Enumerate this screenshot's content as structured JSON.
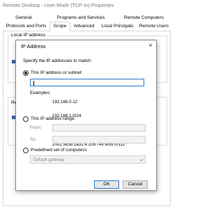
{
  "window": {
    "title": "Remote Desktop - User Mode (TCP-In) Properties"
  },
  "tabs": {
    "row1": [
      "General",
      "Programs and Services",
      "Remote Computers"
    ],
    "row2": [
      "Protocols and Ports",
      "Scope",
      "Advanced",
      "Local Principals",
      "Remote Users"
    ],
    "selected": "Scope"
  },
  "scope": {
    "local_group_label": "Local IP address",
    "remote_group_label": "Re"
  },
  "dialog": {
    "title": "IP Address",
    "close": "×",
    "prompt": "Specify the IP addresses to match:",
    "option_subnet": "This IP address or subnet:",
    "subnet_value": "",
    "examples_label": "Examples:",
    "examples": [
      "192.168.0.12",
      "192.168.1.0/24",
      "2002:9d3b:1a31:4:208:74ff:fe39:6c43",
      "2002:9d3b:1a31:4:208:74ff:fe39:0/112"
    ],
    "option_range": "This IP address range:",
    "from_label": "From:",
    "to_label": "To:",
    "from_value": "",
    "to_value": "",
    "option_predefined": "Predefined set of computers:",
    "predefined_selected": "Default gateway",
    "ok_label": "OK",
    "cancel_label": "Cancel",
    "selected_option": "subnet"
  }
}
